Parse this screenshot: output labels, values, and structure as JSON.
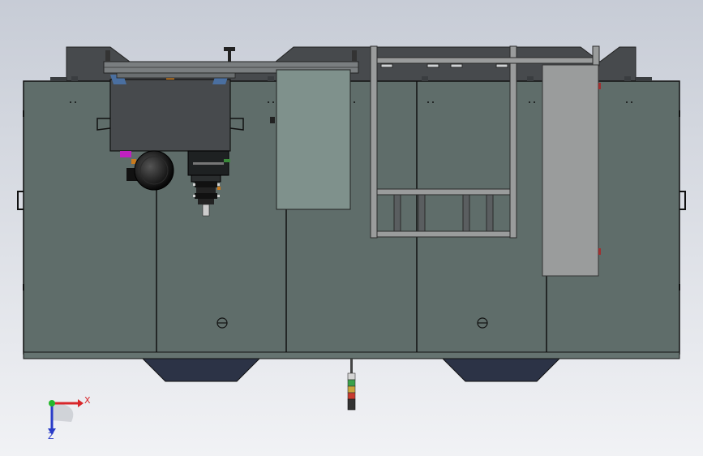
{
  "viewport": {
    "background_top": "#c7ccd6",
    "background_bottom": "#f1f2f5"
  },
  "colors": {
    "panel": "#5f6d6a",
    "panel_edge": "#121a18",
    "frame_dark": "#474a4d",
    "frame_mid": "#7a7e80",
    "glass_panel": "#7f918c",
    "grey_panel": "#9a9c9c",
    "base_plate": "#657370",
    "foot": "#2c3346",
    "accent_blue": "#4a6fa0",
    "accent_orange": "#c87a1e",
    "accent_magenta": "#c020c0",
    "stack_light": [
      "#3aa24a",
      "#c8a43a",
      "#c83a2e"
    ]
  },
  "triad": {
    "x_label": "X",
    "z_label": "Z",
    "x_color": "#d8262a",
    "y_color": "#24b82c",
    "z_color": "#2a3cc8"
  },
  "parts": [
    "top-frame",
    "main-cabinet",
    "hopper-box",
    "spindle-motor",
    "tool-head",
    "glass-access-door",
    "ladder-frame",
    "grey-side-door",
    "base-plate",
    "left-foot",
    "right-foot",
    "signal-stack-light"
  ]
}
